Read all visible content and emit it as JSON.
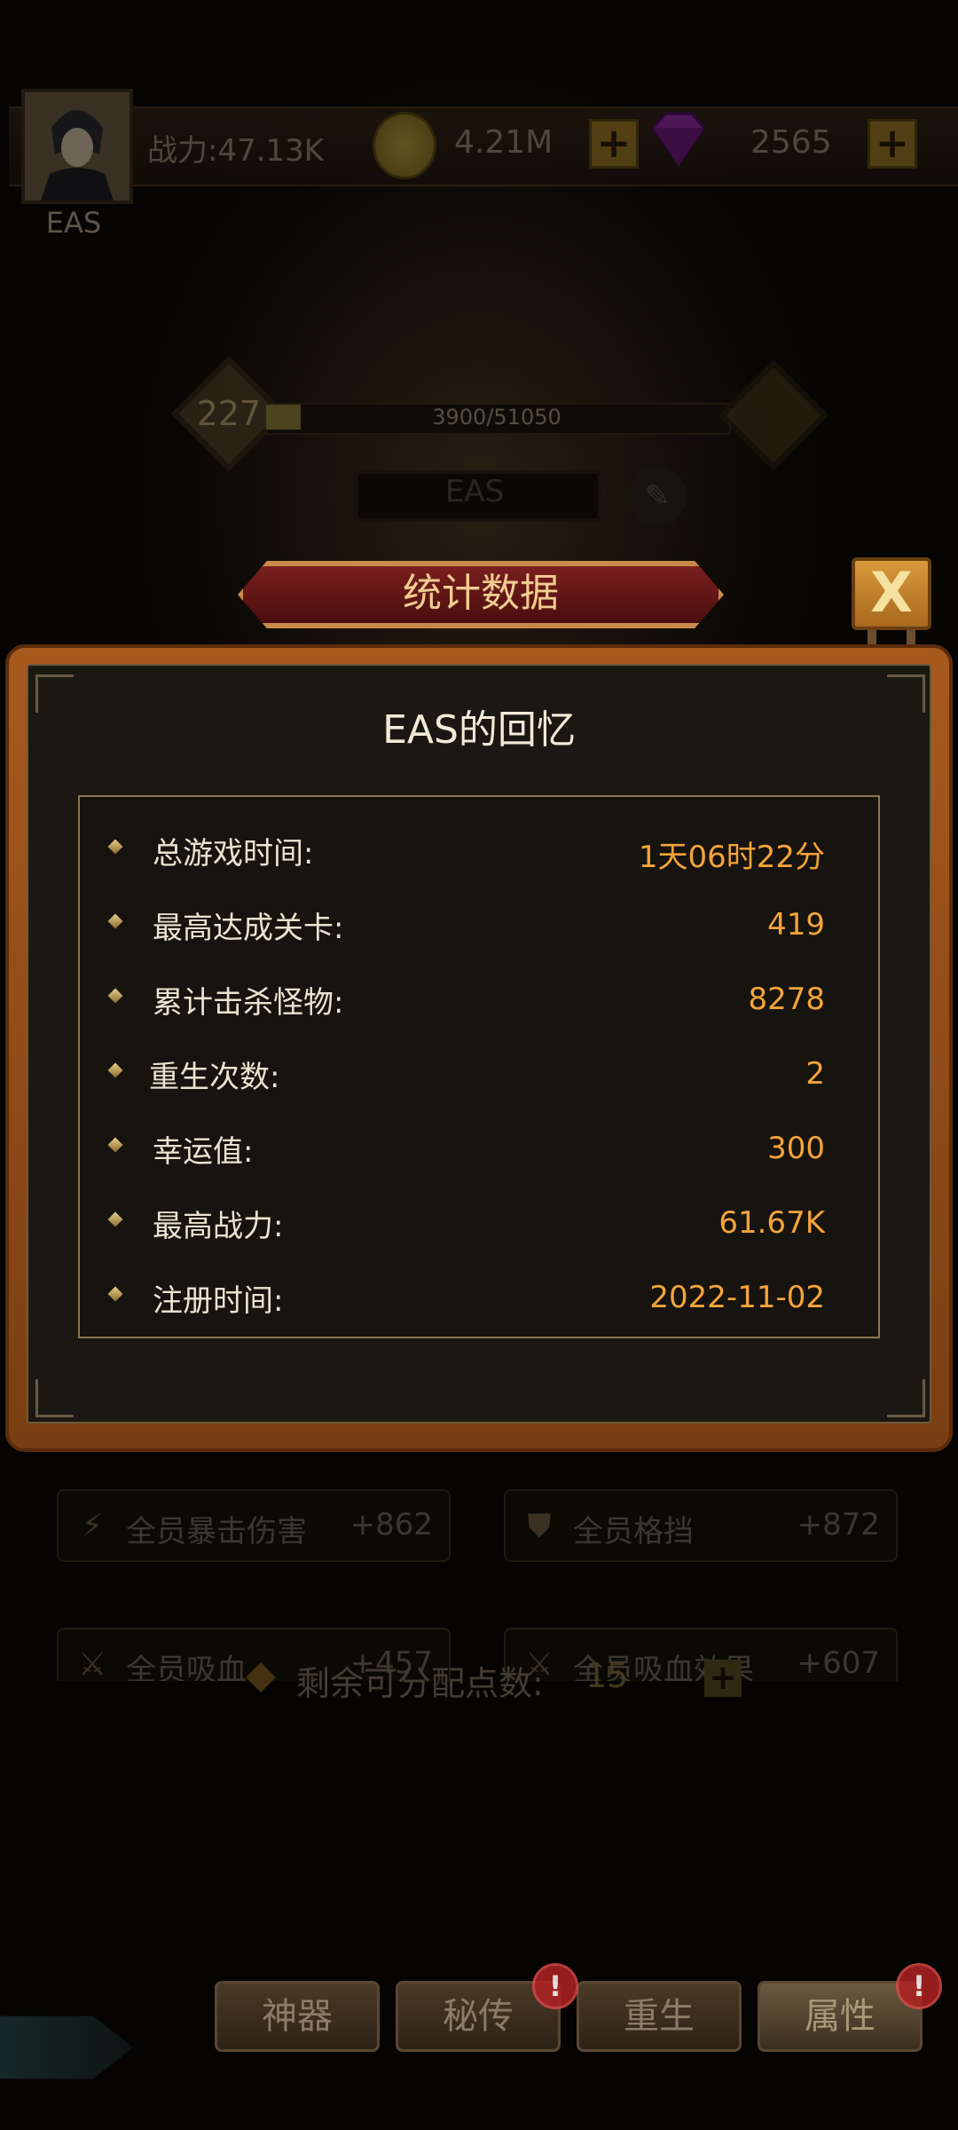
{
  "header": {
    "player_name": "EAS",
    "combat_power": "战力:47.13K",
    "gold": "4.21M",
    "gems": "2565"
  },
  "level": {
    "value": "227",
    "xp_text": "3900/51050",
    "xp_progress": 0.076
  },
  "name_plate": "EAS",
  "dialog": {
    "banner": "统计数据",
    "close_label": "X",
    "title": "EAS的回忆",
    "stats": [
      {
        "label": "总游戏时间:",
        "value": "1天06时22分"
      },
      {
        "label": "最高达成关卡:",
        "value": "419"
      },
      {
        "label": "累计击杀怪物:",
        "value": "8278"
      },
      {
        "label": "重生次数:",
        "value": "2"
      },
      {
        "label": "幸运值:",
        "value": "300"
      },
      {
        "label": "最高战力:",
        "value": "61.67K"
      },
      {
        "label": "注册时间:",
        "value": "2022-11-02"
      }
    ]
  },
  "attributes": [
    {
      "label": "全员暴击伤害",
      "value": "+862",
      "icon": "crit-damage-icon"
    },
    {
      "label": "全员格挡",
      "value": "+872",
      "icon": "shield-icon"
    },
    {
      "label": "全员吸血",
      "value": "+457",
      "icon": "lifesteal-icon"
    },
    {
      "label": "全员吸血效果",
      "value": "+607",
      "icon": "lifesteal-effect-icon"
    }
  ],
  "points": {
    "label": "剩余可分配点数:",
    "value": "15"
  },
  "nav": {
    "tabs": [
      {
        "label": "神器",
        "alert": false
      },
      {
        "label": "秘传",
        "alert": true
      },
      {
        "label": "重生",
        "alert": false
      },
      {
        "label": "属性",
        "alert": true
      }
    ],
    "alert_mark": "!"
  },
  "colors": {
    "accent_orange": "#f4a43a",
    "dialog_frame": "#a85a1e",
    "banner_red": "#7a1e1e"
  }
}
